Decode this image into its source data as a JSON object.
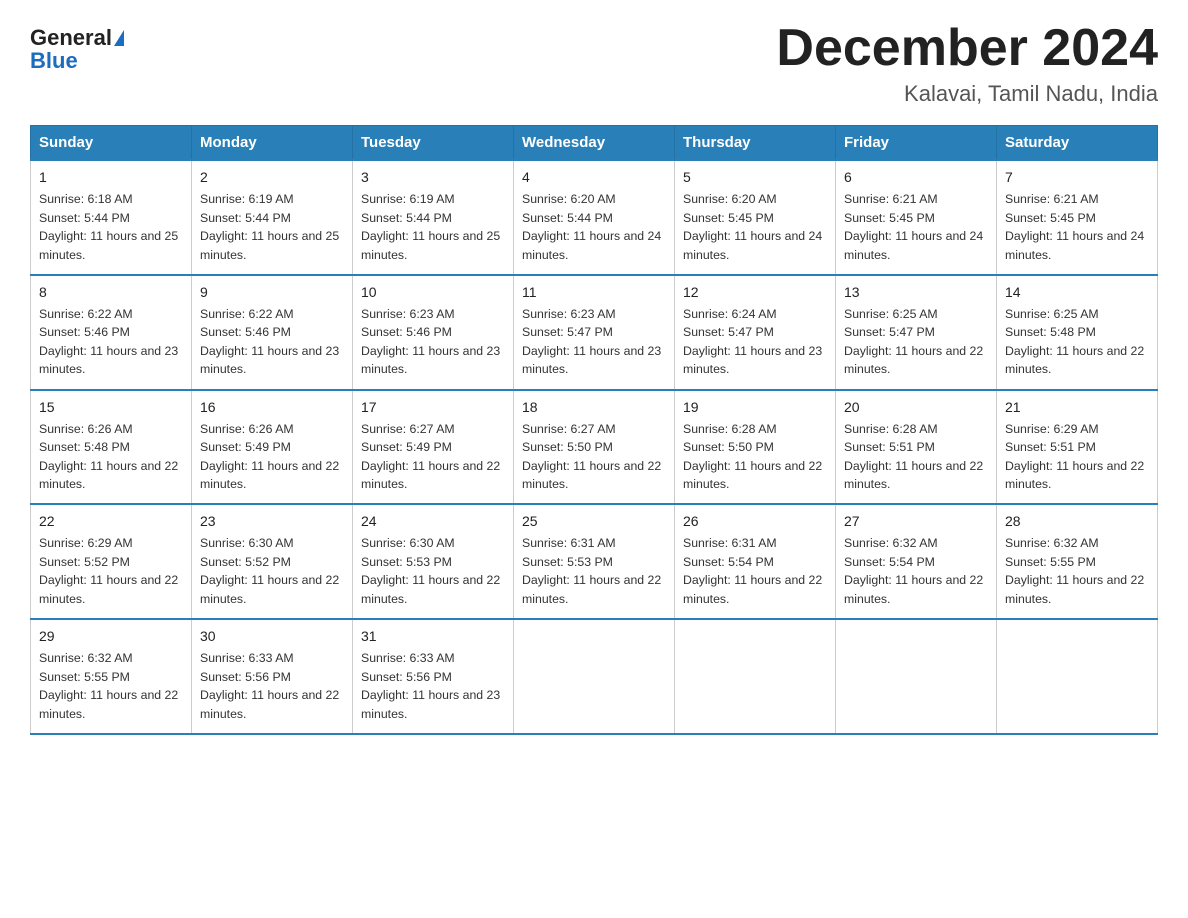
{
  "header": {
    "logo_general": "General",
    "logo_blue": "Blue",
    "title": "December 2024",
    "subtitle": "Kalavai, Tamil Nadu, India"
  },
  "days_of_week": [
    "Sunday",
    "Monday",
    "Tuesday",
    "Wednesday",
    "Thursday",
    "Friday",
    "Saturday"
  ],
  "weeks": [
    [
      {
        "day": "1",
        "sunrise": "Sunrise: 6:18 AM",
        "sunset": "Sunset: 5:44 PM",
        "daylight": "Daylight: 11 hours and 25 minutes."
      },
      {
        "day": "2",
        "sunrise": "Sunrise: 6:19 AM",
        "sunset": "Sunset: 5:44 PM",
        "daylight": "Daylight: 11 hours and 25 minutes."
      },
      {
        "day": "3",
        "sunrise": "Sunrise: 6:19 AM",
        "sunset": "Sunset: 5:44 PM",
        "daylight": "Daylight: 11 hours and 25 minutes."
      },
      {
        "day": "4",
        "sunrise": "Sunrise: 6:20 AM",
        "sunset": "Sunset: 5:44 PM",
        "daylight": "Daylight: 11 hours and 24 minutes."
      },
      {
        "day": "5",
        "sunrise": "Sunrise: 6:20 AM",
        "sunset": "Sunset: 5:45 PM",
        "daylight": "Daylight: 11 hours and 24 minutes."
      },
      {
        "day": "6",
        "sunrise": "Sunrise: 6:21 AM",
        "sunset": "Sunset: 5:45 PM",
        "daylight": "Daylight: 11 hours and 24 minutes."
      },
      {
        "day": "7",
        "sunrise": "Sunrise: 6:21 AM",
        "sunset": "Sunset: 5:45 PM",
        "daylight": "Daylight: 11 hours and 24 minutes."
      }
    ],
    [
      {
        "day": "8",
        "sunrise": "Sunrise: 6:22 AM",
        "sunset": "Sunset: 5:46 PM",
        "daylight": "Daylight: 11 hours and 23 minutes."
      },
      {
        "day": "9",
        "sunrise": "Sunrise: 6:22 AM",
        "sunset": "Sunset: 5:46 PM",
        "daylight": "Daylight: 11 hours and 23 minutes."
      },
      {
        "day": "10",
        "sunrise": "Sunrise: 6:23 AM",
        "sunset": "Sunset: 5:46 PM",
        "daylight": "Daylight: 11 hours and 23 minutes."
      },
      {
        "day": "11",
        "sunrise": "Sunrise: 6:23 AM",
        "sunset": "Sunset: 5:47 PM",
        "daylight": "Daylight: 11 hours and 23 minutes."
      },
      {
        "day": "12",
        "sunrise": "Sunrise: 6:24 AM",
        "sunset": "Sunset: 5:47 PM",
        "daylight": "Daylight: 11 hours and 23 minutes."
      },
      {
        "day": "13",
        "sunrise": "Sunrise: 6:25 AM",
        "sunset": "Sunset: 5:47 PM",
        "daylight": "Daylight: 11 hours and 22 minutes."
      },
      {
        "day": "14",
        "sunrise": "Sunrise: 6:25 AM",
        "sunset": "Sunset: 5:48 PM",
        "daylight": "Daylight: 11 hours and 22 minutes."
      }
    ],
    [
      {
        "day": "15",
        "sunrise": "Sunrise: 6:26 AM",
        "sunset": "Sunset: 5:48 PM",
        "daylight": "Daylight: 11 hours and 22 minutes."
      },
      {
        "day": "16",
        "sunrise": "Sunrise: 6:26 AM",
        "sunset": "Sunset: 5:49 PM",
        "daylight": "Daylight: 11 hours and 22 minutes."
      },
      {
        "day": "17",
        "sunrise": "Sunrise: 6:27 AM",
        "sunset": "Sunset: 5:49 PM",
        "daylight": "Daylight: 11 hours and 22 minutes."
      },
      {
        "day": "18",
        "sunrise": "Sunrise: 6:27 AM",
        "sunset": "Sunset: 5:50 PM",
        "daylight": "Daylight: 11 hours and 22 minutes."
      },
      {
        "day": "19",
        "sunrise": "Sunrise: 6:28 AM",
        "sunset": "Sunset: 5:50 PM",
        "daylight": "Daylight: 11 hours and 22 minutes."
      },
      {
        "day": "20",
        "sunrise": "Sunrise: 6:28 AM",
        "sunset": "Sunset: 5:51 PM",
        "daylight": "Daylight: 11 hours and 22 minutes."
      },
      {
        "day": "21",
        "sunrise": "Sunrise: 6:29 AM",
        "sunset": "Sunset: 5:51 PM",
        "daylight": "Daylight: 11 hours and 22 minutes."
      }
    ],
    [
      {
        "day": "22",
        "sunrise": "Sunrise: 6:29 AM",
        "sunset": "Sunset: 5:52 PM",
        "daylight": "Daylight: 11 hours and 22 minutes."
      },
      {
        "day": "23",
        "sunrise": "Sunrise: 6:30 AM",
        "sunset": "Sunset: 5:52 PM",
        "daylight": "Daylight: 11 hours and 22 minutes."
      },
      {
        "day": "24",
        "sunrise": "Sunrise: 6:30 AM",
        "sunset": "Sunset: 5:53 PM",
        "daylight": "Daylight: 11 hours and 22 minutes."
      },
      {
        "day": "25",
        "sunrise": "Sunrise: 6:31 AM",
        "sunset": "Sunset: 5:53 PM",
        "daylight": "Daylight: 11 hours and 22 minutes."
      },
      {
        "day": "26",
        "sunrise": "Sunrise: 6:31 AM",
        "sunset": "Sunset: 5:54 PM",
        "daylight": "Daylight: 11 hours and 22 minutes."
      },
      {
        "day": "27",
        "sunrise": "Sunrise: 6:32 AM",
        "sunset": "Sunset: 5:54 PM",
        "daylight": "Daylight: 11 hours and 22 minutes."
      },
      {
        "day": "28",
        "sunrise": "Sunrise: 6:32 AM",
        "sunset": "Sunset: 5:55 PM",
        "daylight": "Daylight: 11 hours and 22 minutes."
      }
    ],
    [
      {
        "day": "29",
        "sunrise": "Sunrise: 6:32 AM",
        "sunset": "Sunset: 5:55 PM",
        "daylight": "Daylight: 11 hours and 22 minutes."
      },
      {
        "day": "30",
        "sunrise": "Sunrise: 6:33 AM",
        "sunset": "Sunset: 5:56 PM",
        "daylight": "Daylight: 11 hours and 22 minutes."
      },
      {
        "day": "31",
        "sunrise": "Sunrise: 6:33 AM",
        "sunset": "Sunset: 5:56 PM",
        "daylight": "Daylight: 11 hours and 23 minutes."
      },
      null,
      null,
      null,
      null
    ]
  ]
}
